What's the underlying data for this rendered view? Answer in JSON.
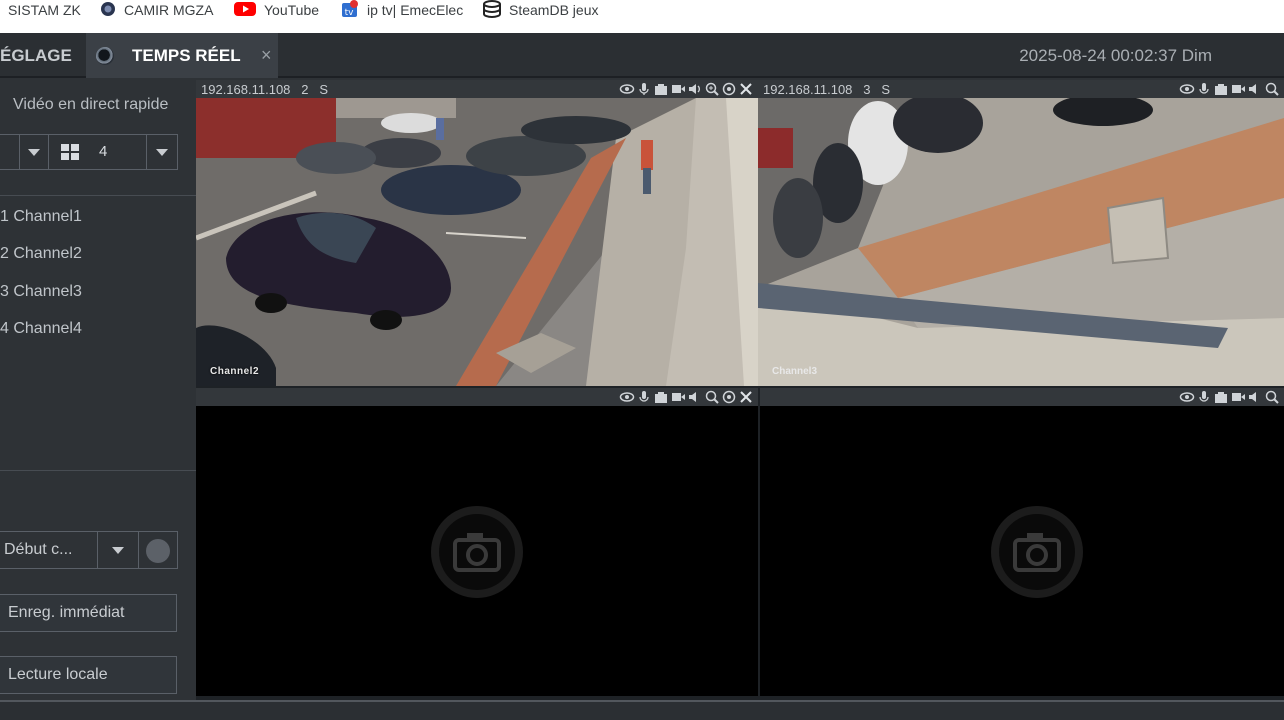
{
  "bookmarks": [
    {
      "label": "SISTAM ZK",
      "icon": "none"
    },
    {
      "label": "CAMIR MGZA",
      "icon": "camera-lens-icon"
    },
    {
      "label": "YouTube",
      "icon": "youtube-icon"
    },
    {
      "label": "ip tv| EmecElec",
      "icon": "iptv-icon"
    },
    {
      "label": "SteamDB jeux",
      "icon": "steamdb-icon"
    }
  ],
  "tabs": {
    "reglage": "ÉGLAGE",
    "temps_reel": "TEMPS RÉEL",
    "close": "×"
  },
  "datetime": "2025-08-24 00:02:37 Dim",
  "left": {
    "title": "Vidéo en direct rapide",
    "split_value": "4",
    "channels": [
      "1 Channel1",
      "2 Channel2",
      "3 Channel3",
      "4 Channel4"
    ],
    "record_select": "Début c...",
    "btn_enreg": "Enreg. immédiat",
    "btn_lecture": "Lecture locale"
  },
  "tiles": [
    {
      "ip": "192.168.11.108",
      "ch": "2",
      "stream": "S",
      "osd": "Channel2",
      "state": "live"
    },
    {
      "ip": "192.168.11.108",
      "ch": "3",
      "stream": "S",
      "osd": "Channel3",
      "state": "live"
    },
    {
      "ip": "",
      "ch": "",
      "stream": "",
      "osd": "",
      "state": "no-video"
    },
    {
      "ip": "",
      "ch": "",
      "stream": "",
      "osd": "",
      "state": "no-video"
    }
  ],
  "tool_icons": [
    "eye-icon",
    "microphone-icon",
    "snapshot-icon",
    "record-icon",
    "speaker-icon",
    "zoom-icon",
    "ptz-icon",
    "close-icon"
  ],
  "colors": {
    "accent": "#ffffff",
    "panel": "#2e3236",
    "bar": "#2b2f33"
  }
}
